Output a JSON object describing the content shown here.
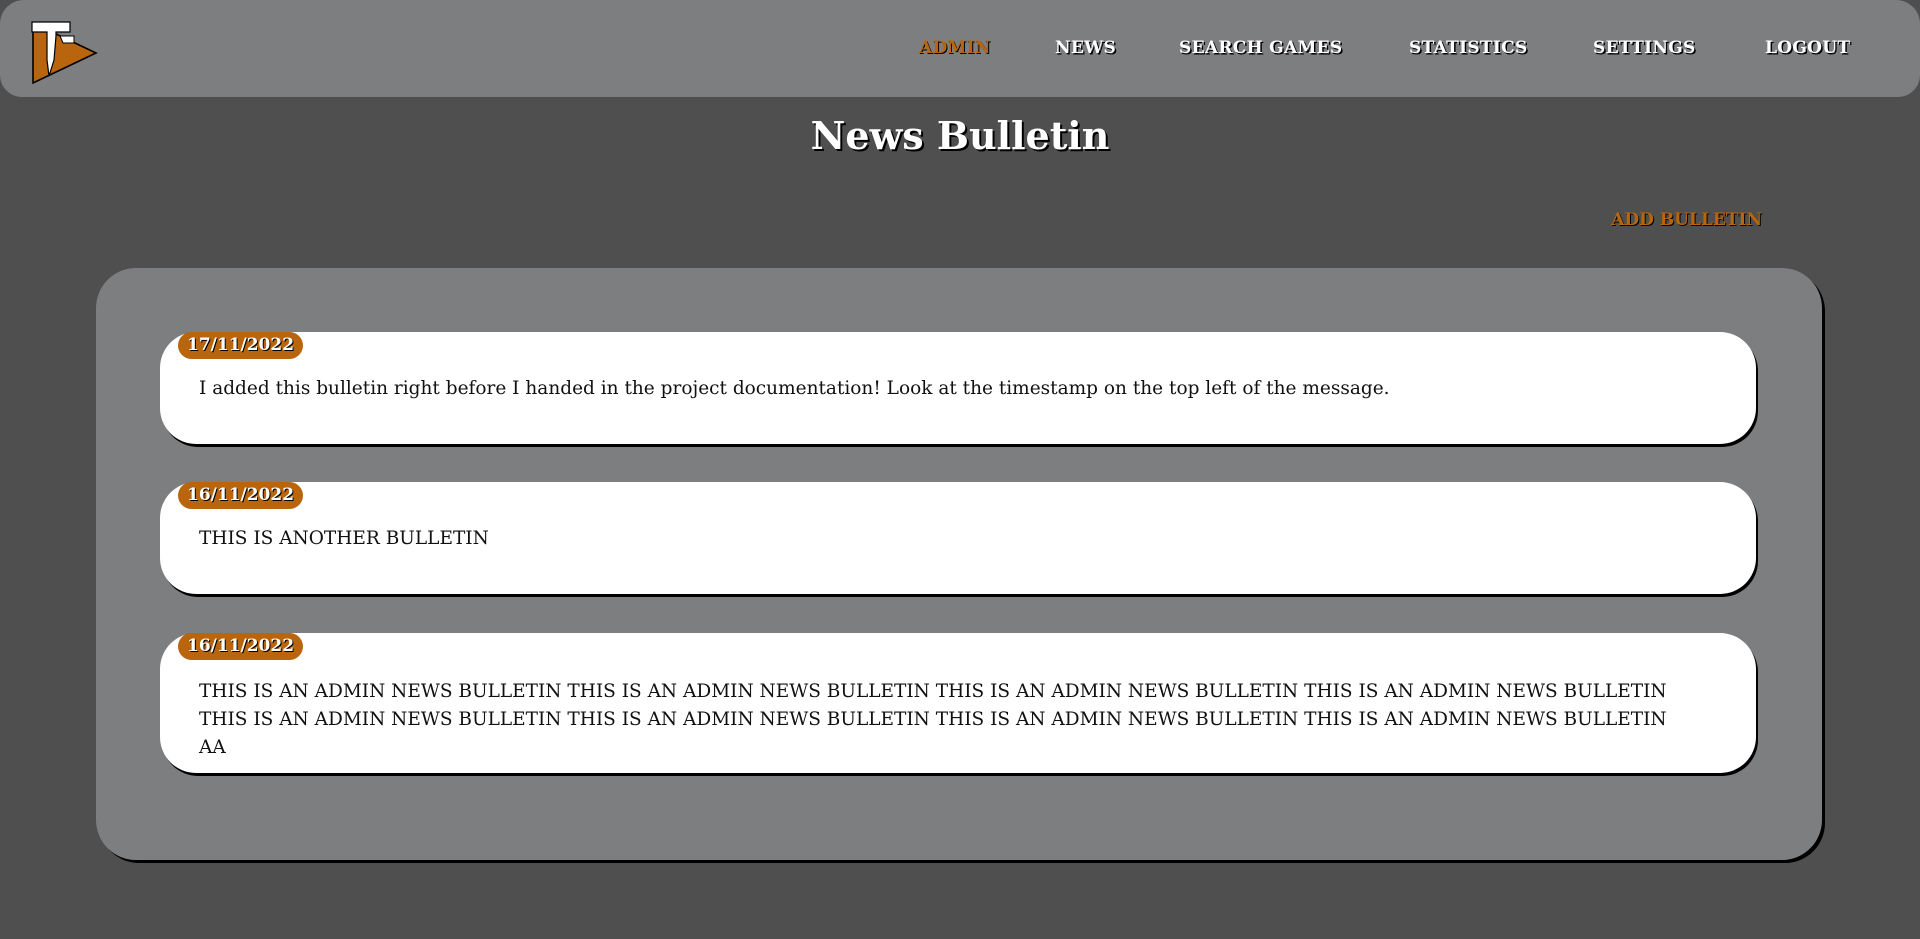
{
  "header": {
    "nav": [
      {
        "label": "ADMIN",
        "active": true
      },
      {
        "label": "NEWS",
        "active": false
      },
      {
        "label": "SEARCH GAMES",
        "active": false
      },
      {
        "label": "STATISTICS",
        "active": false
      },
      {
        "label": "SETTINGS",
        "active": false
      },
      {
        "label": "LOGOUT",
        "active": false
      }
    ],
    "logo_icon": "tf-logo-icon"
  },
  "main": {
    "title": "News Bulletin",
    "add_label": "ADD BULLETIN",
    "bulletins": [
      {
        "date": "17/11/2022",
        "text": "I added this bulletin right before I handed in the project documentation! Look at the timestamp on the top left of the message."
      },
      {
        "date": "16/11/2022",
        "text": "THIS IS ANOTHER BULLETIN"
      },
      {
        "date": "16/11/2022",
        "text": "THIS IS AN ADMIN NEWS BULLETIN THIS IS AN ADMIN NEWS BULLETIN THIS IS AN ADMIN NEWS BULLETIN THIS IS AN ADMIN NEWS BULLETIN THIS IS AN ADMIN NEWS BULLETIN THIS IS AN ADMIN NEWS BULLETIN THIS IS AN ADMIN NEWS BULLETIN THIS IS AN ADMIN NEWS BULLETIN AA"
      }
    ]
  },
  "colors": {
    "background": "#4f4f4f",
    "bar": "#7d7e80",
    "accent": "#b8650e",
    "card": "#ffffff"
  }
}
